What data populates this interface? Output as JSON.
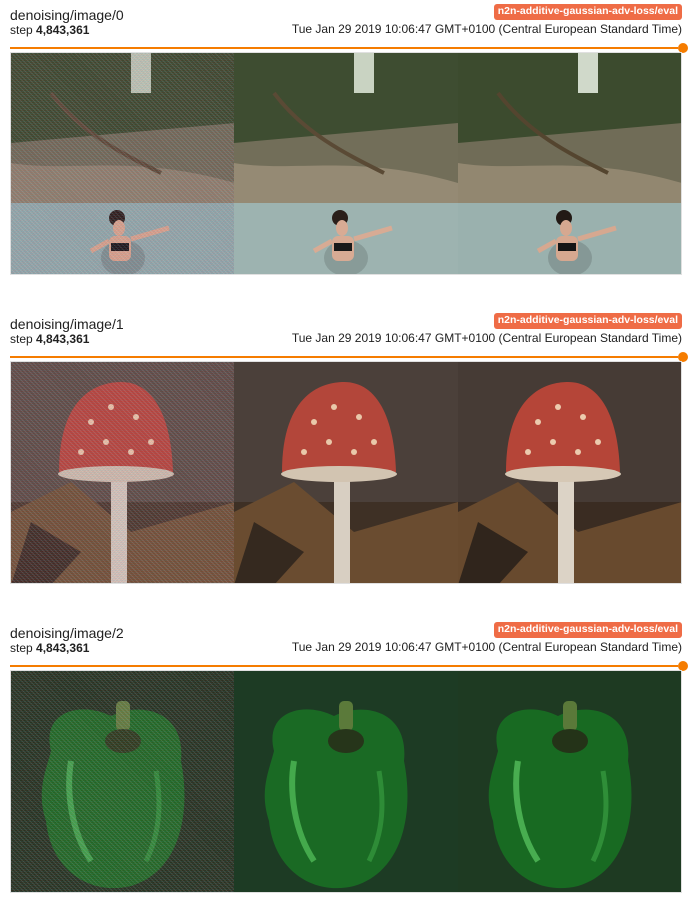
{
  "cards": [
    {
      "title": "denoising/image/0",
      "run_badge": "n2n-additive-gaussian-adv-loss/eval",
      "step_label": "step",
      "step_value": "4,843,361",
      "timestamp": "Tue Jan 29 2019 10:06:47 GMT+0100 (Central European Standard Time)",
      "image_subject": "woman-in-river",
      "panels": [
        "noisy-input",
        "denoised-output",
        "clean-target"
      ]
    },
    {
      "title": "denoising/image/1",
      "run_badge": "n2n-additive-gaussian-adv-loss/eval",
      "step_label": "step",
      "step_value": "4,843,361",
      "timestamp": "Tue Jan 29 2019 10:06:47 GMT+0100 (Central European Standard Time)",
      "image_subject": "red-mushroom",
      "panels": [
        "noisy-input",
        "denoised-output",
        "clean-target"
      ]
    },
    {
      "title": "denoising/image/2",
      "run_badge": "n2n-additive-gaussian-adv-loss/eval",
      "step_label": "step",
      "step_value": "4,843,361",
      "timestamp": "Tue Jan 29 2019 10:06:47 GMT+0100 (Central European Standard Time)",
      "image_subject": "green-pepper",
      "panels": [
        "noisy-input",
        "denoised-output",
        "clean-target"
      ]
    }
  ],
  "colors": {
    "accent": "#f57c00",
    "badge": "#ef6c46",
    "text": "#212121"
  }
}
